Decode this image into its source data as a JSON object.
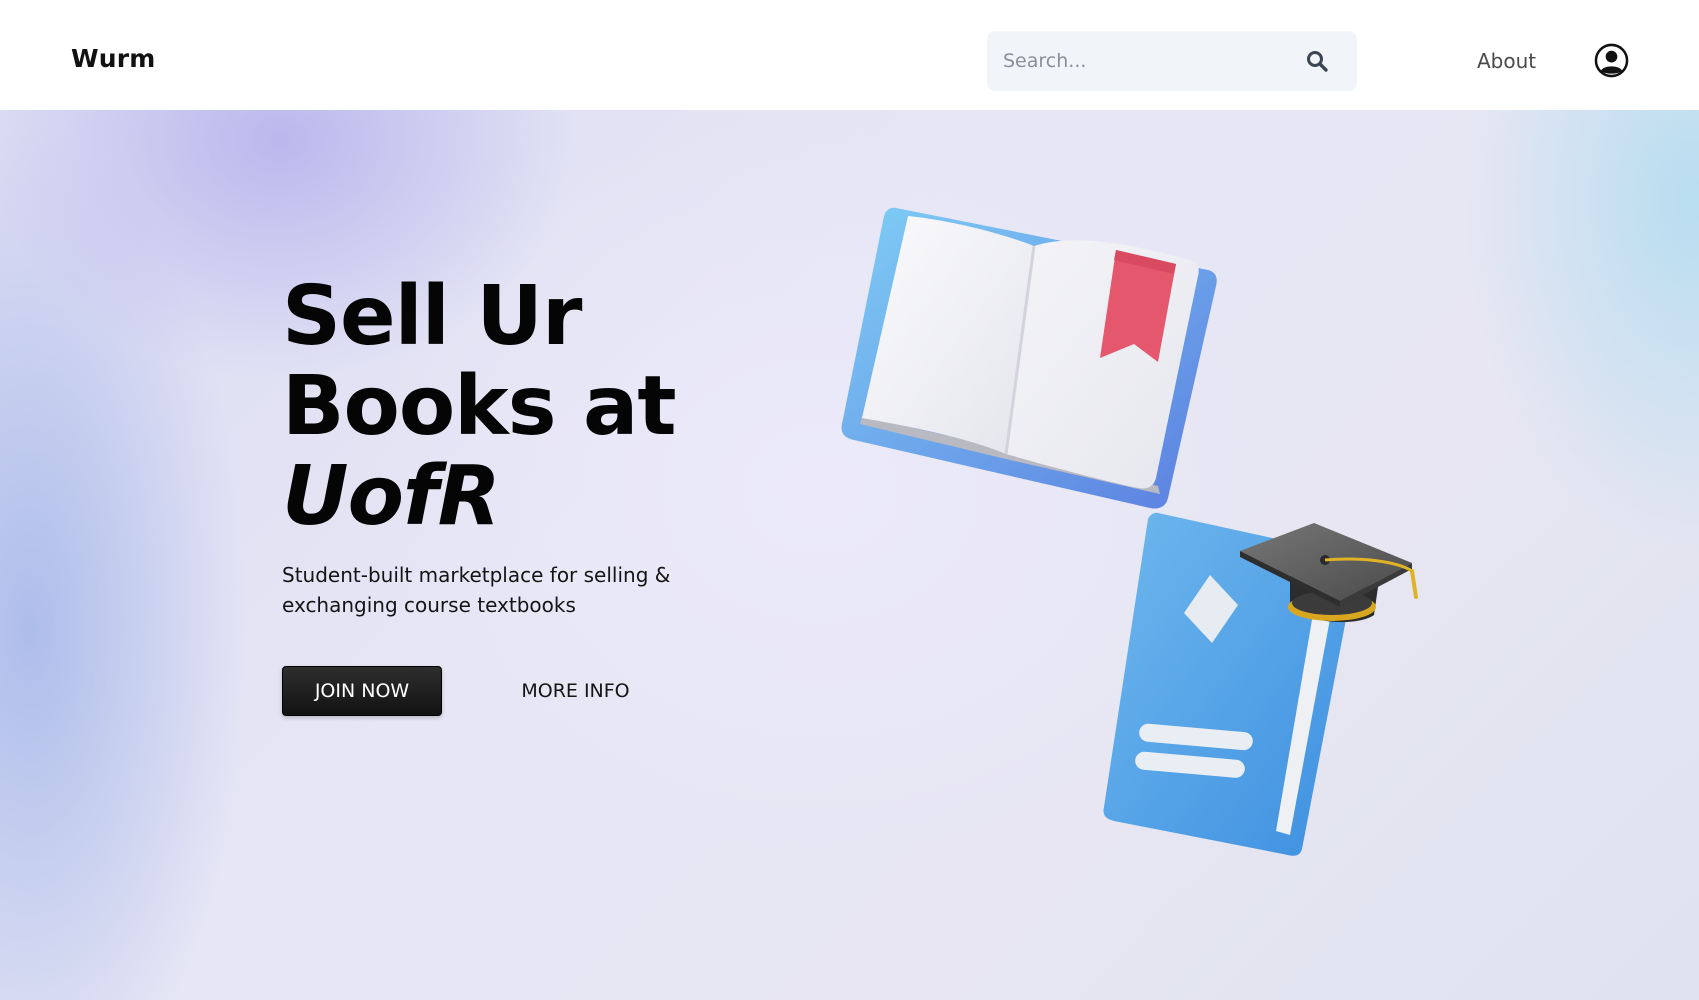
{
  "navbar": {
    "brand": "Wurm",
    "search": {
      "placeholder": "Search...",
      "value": ""
    },
    "about_label": "About"
  },
  "hero": {
    "headline_line1": "Sell Ur",
    "headline_line2": "Books at",
    "headline_line3": "UofR",
    "subtitle": "Student-built marketplace for selling & exchanging course textbooks",
    "join_label": "JOIN NOW",
    "more_label": "MORE INFO"
  },
  "icons": {
    "search": "search-icon",
    "account": "user-circle-icon",
    "open_book": "open-book-illustration",
    "closed_book": "closed-book-with-graduation-cap-illustration"
  },
  "colors": {
    "nav_background": "#ffffff",
    "search_background": "#f1f4f9",
    "button_dark": "#121212",
    "bookmark_red": "#e5576c",
    "book_blue": "#4f9be2",
    "cap_gray": "#5c5c5c",
    "tassel_gold": "#e0b325"
  }
}
